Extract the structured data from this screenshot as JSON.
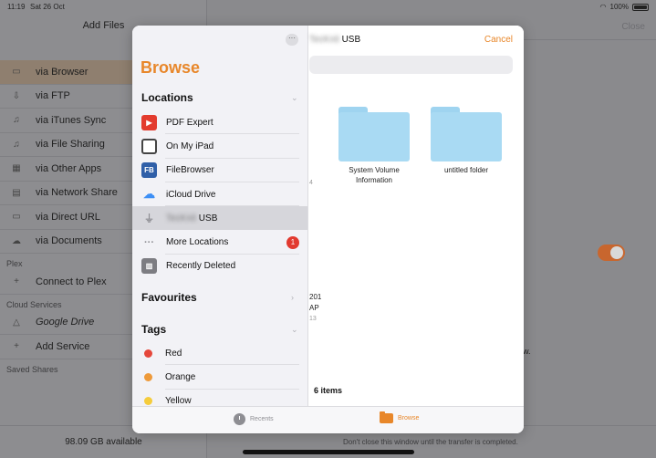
{
  "status": {
    "time": "11:19",
    "date": "Sat 26 Oct",
    "battery": "100%"
  },
  "background": {
    "title": "Add Files",
    "close": "Close",
    "items": [
      {
        "label": "via Browser",
        "icon": "browser-icon"
      },
      {
        "label": "via FTP",
        "icon": "ftp-icon"
      },
      {
        "label": "via iTunes Sync",
        "icon": "itunes-icon"
      },
      {
        "label": "via File Sharing",
        "icon": "file-sharing-icon"
      },
      {
        "label": "via Other Apps",
        "icon": "other-apps-icon"
      },
      {
        "label": "via Network Share",
        "icon": "network-share-icon"
      },
      {
        "label": "via Direct URL",
        "icon": "direct-url-icon"
      },
      {
        "label": "via Documents",
        "icon": "documents-icon"
      }
    ],
    "sections": {
      "plex": "Plex",
      "cloud": "Cloud Services",
      "saved": "Saved Shares"
    },
    "plex_item": "Connect to Plex",
    "cloud_items": [
      "Google Drive",
      "Add Service"
    ],
    "storage": "98.09 GB available",
    "right_partial": "w.",
    "footer_note": "Don't close this window until the transfer is completed."
  },
  "sheet": {
    "browse_title": "Browse",
    "locations_title": "Locations",
    "locations": [
      {
        "label": "PDF Expert",
        "color": "#e33b2e",
        "glyph": "PDF"
      },
      {
        "label": "On My iPad",
        "color": "#555555",
        "glyph": ""
      },
      {
        "label": "FileBrowser",
        "color": "#2f5fa8",
        "glyph": "FB"
      },
      {
        "label": "iCloud Drive",
        "color": "#3d8ff5",
        "glyph": ""
      },
      {
        "label": "USB",
        "color": "#a0a0a6",
        "glyph": ""
      },
      {
        "label": "More Locations",
        "badge": "1"
      },
      {
        "label": "Recently Deleted",
        "color": "#7d7d82",
        "glyph": ""
      }
    ],
    "favourites_title": "Favourites",
    "tags_title": "Tags",
    "tags": [
      {
        "label": "Red",
        "color": "#e5473b"
      },
      {
        "label": "Orange",
        "color": "#ee9a3a"
      },
      {
        "label": "Yellow",
        "color": "#f5cc3c"
      }
    ],
    "right_title": "USB",
    "cancel": "Cancel",
    "folders": [
      {
        "name_line1": "System Volume",
        "name_line2": "Information"
      },
      {
        "name_line1": "untitled folder",
        "name_line2": ""
      }
    ],
    "partial_texts": [
      "201",
      "AP",
      "13",
      "4"
    ],
    "items_count": "6 items",
    "tabs": {
      "recents": "Recents",
      "browse": "Browse"
    }
  }
}
